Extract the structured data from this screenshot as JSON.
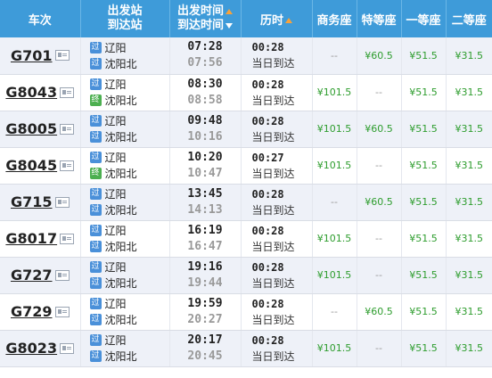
{
  "header": {
    "train": "车次",
    "station_l1": "出发站",
    "station_l2": "到达站",
    "time_l1": "出发时间",
    "time_l2": "到达时间",
    "duration": "历时",
    "business": "商务座",
    "premium": "特等座",
    "first": "一等座",
    "second": "二等座"
  },
  "icons": {
    "pass": "过",
    "end": "终"
  },
  "rows": [
    {
      "train": "G701",
      "from": "辽阳",
      "to": "沈阳北",
      "from_type": "pass",
      "to_type": "pass",
      "dep": "07:28",
      "arr": "07:56",
      "dur": "00:28",
      "note": "当日到达",
      "business": "--",
      "premium": "¥60.5",
      "first": "¥51.5",
      "second": "¥31.5"
    },
    {
      "train": "G8043",
      "from": "辽阳",
      "to": "沈阳北",
      "from_type": "pass",
      "to_type": "end",
      "dep": "08:30",
      "arr": "08:58",
      "dur": "00:28",
      "note": "当日到达",
      "business": "¥101.5",
      "premium": "--",
      "first": "¥51.5",
      "second": "¥31.5"
    },
    {
      "train": "G8005",
      "from": "辽阳",
      "to": "沈阳北",
      "from_type": "pass",
      "to_type": "pass",
      "dep": "09:48",
      "arr": "10:16",
      "dur": "00:28",
      "note": "当日到达",
      "business": "¥101.5",
      "premium": "¥60.5",
      "first": "¥51.5",
      "second": "¥31.5"
    },
    {
      "train": "G8045",
      "from": "辽阳",
      "to": "沈阳北",
      "from_type": "pass",
      "to_type": "end",
      "dep": "10:20",
      "arr": "10:47",
      "dur": "00:27",
      "note": "当日到达",
      "business": "¥101.5",
      "premium": "--",
      "first": "¥51.5",
      "second": "¥31.5"
    },
    {
      "train": "G715",
      "from": "辽阳",
      "to": "沈阳北",
      "from_type": "pass",
      "to_type": "pass",
      "dep": "13:45",
      "arr": "14:13",
      "dur": "00:28",
      "note": "当日到达",
      "business": "--",
      "premium": "¥60.5",
      "first": "¥51.5",
      "second": "¥31.5"
    },
    {
      "train": "G8017",
      "from": "辽阳",
      "to": "沈阳北",
      "from_type": "pass",
      "to_type": "pass",
      "dep": "16:19",
      "arr": "16:47",
      "dur": "00:28",
      "note": "当日到达",
      "business": "¥101.5",
      "premium": "--",
      "first": "¥51.5",
      "second": "¥31.5"
    },
    {
      "train": "G727",
      "from": "辽阳",
      "to": "沈阳北",
      "from_type": "pass",
      "to_type": "pass",
      "dep": "19:16",
      "arr": "19:44",
      "dur": "00:28",
      "note": "当日到达",
      "business": "¥101.5",
      "premium": "--",
      "first": "¥51.5",
      "second": "¥31.5"
    },
    {
      "train": "G729",
      "from": "辽阳",
      "to": "沈阳北",
      "from_type": "pass",
      "to_type": "pass",
      "dep": "19:59",
      "arr": "20:27",
      "dur": "00:28",
      "note": "当日到达",
      "business": "--",
      "premium": "¥60.5",
      "first": "¥51.5",
      "second": "¥31.5"
    },
    {
      "train": "G8023",
      "from": "辽阳",
      "to": "沈阳北",
      "from_type": "pass",
      "to_type": "pass",
      "dep": "20:17",
      "arr": "20:45",
      "dur": "00:28",
      "note": "当日到达",
      "business": "¥101.5",
      "premium": "--",
      "first": "¥51.5",
      "second": "¥31.5"
    }
  ]
}
